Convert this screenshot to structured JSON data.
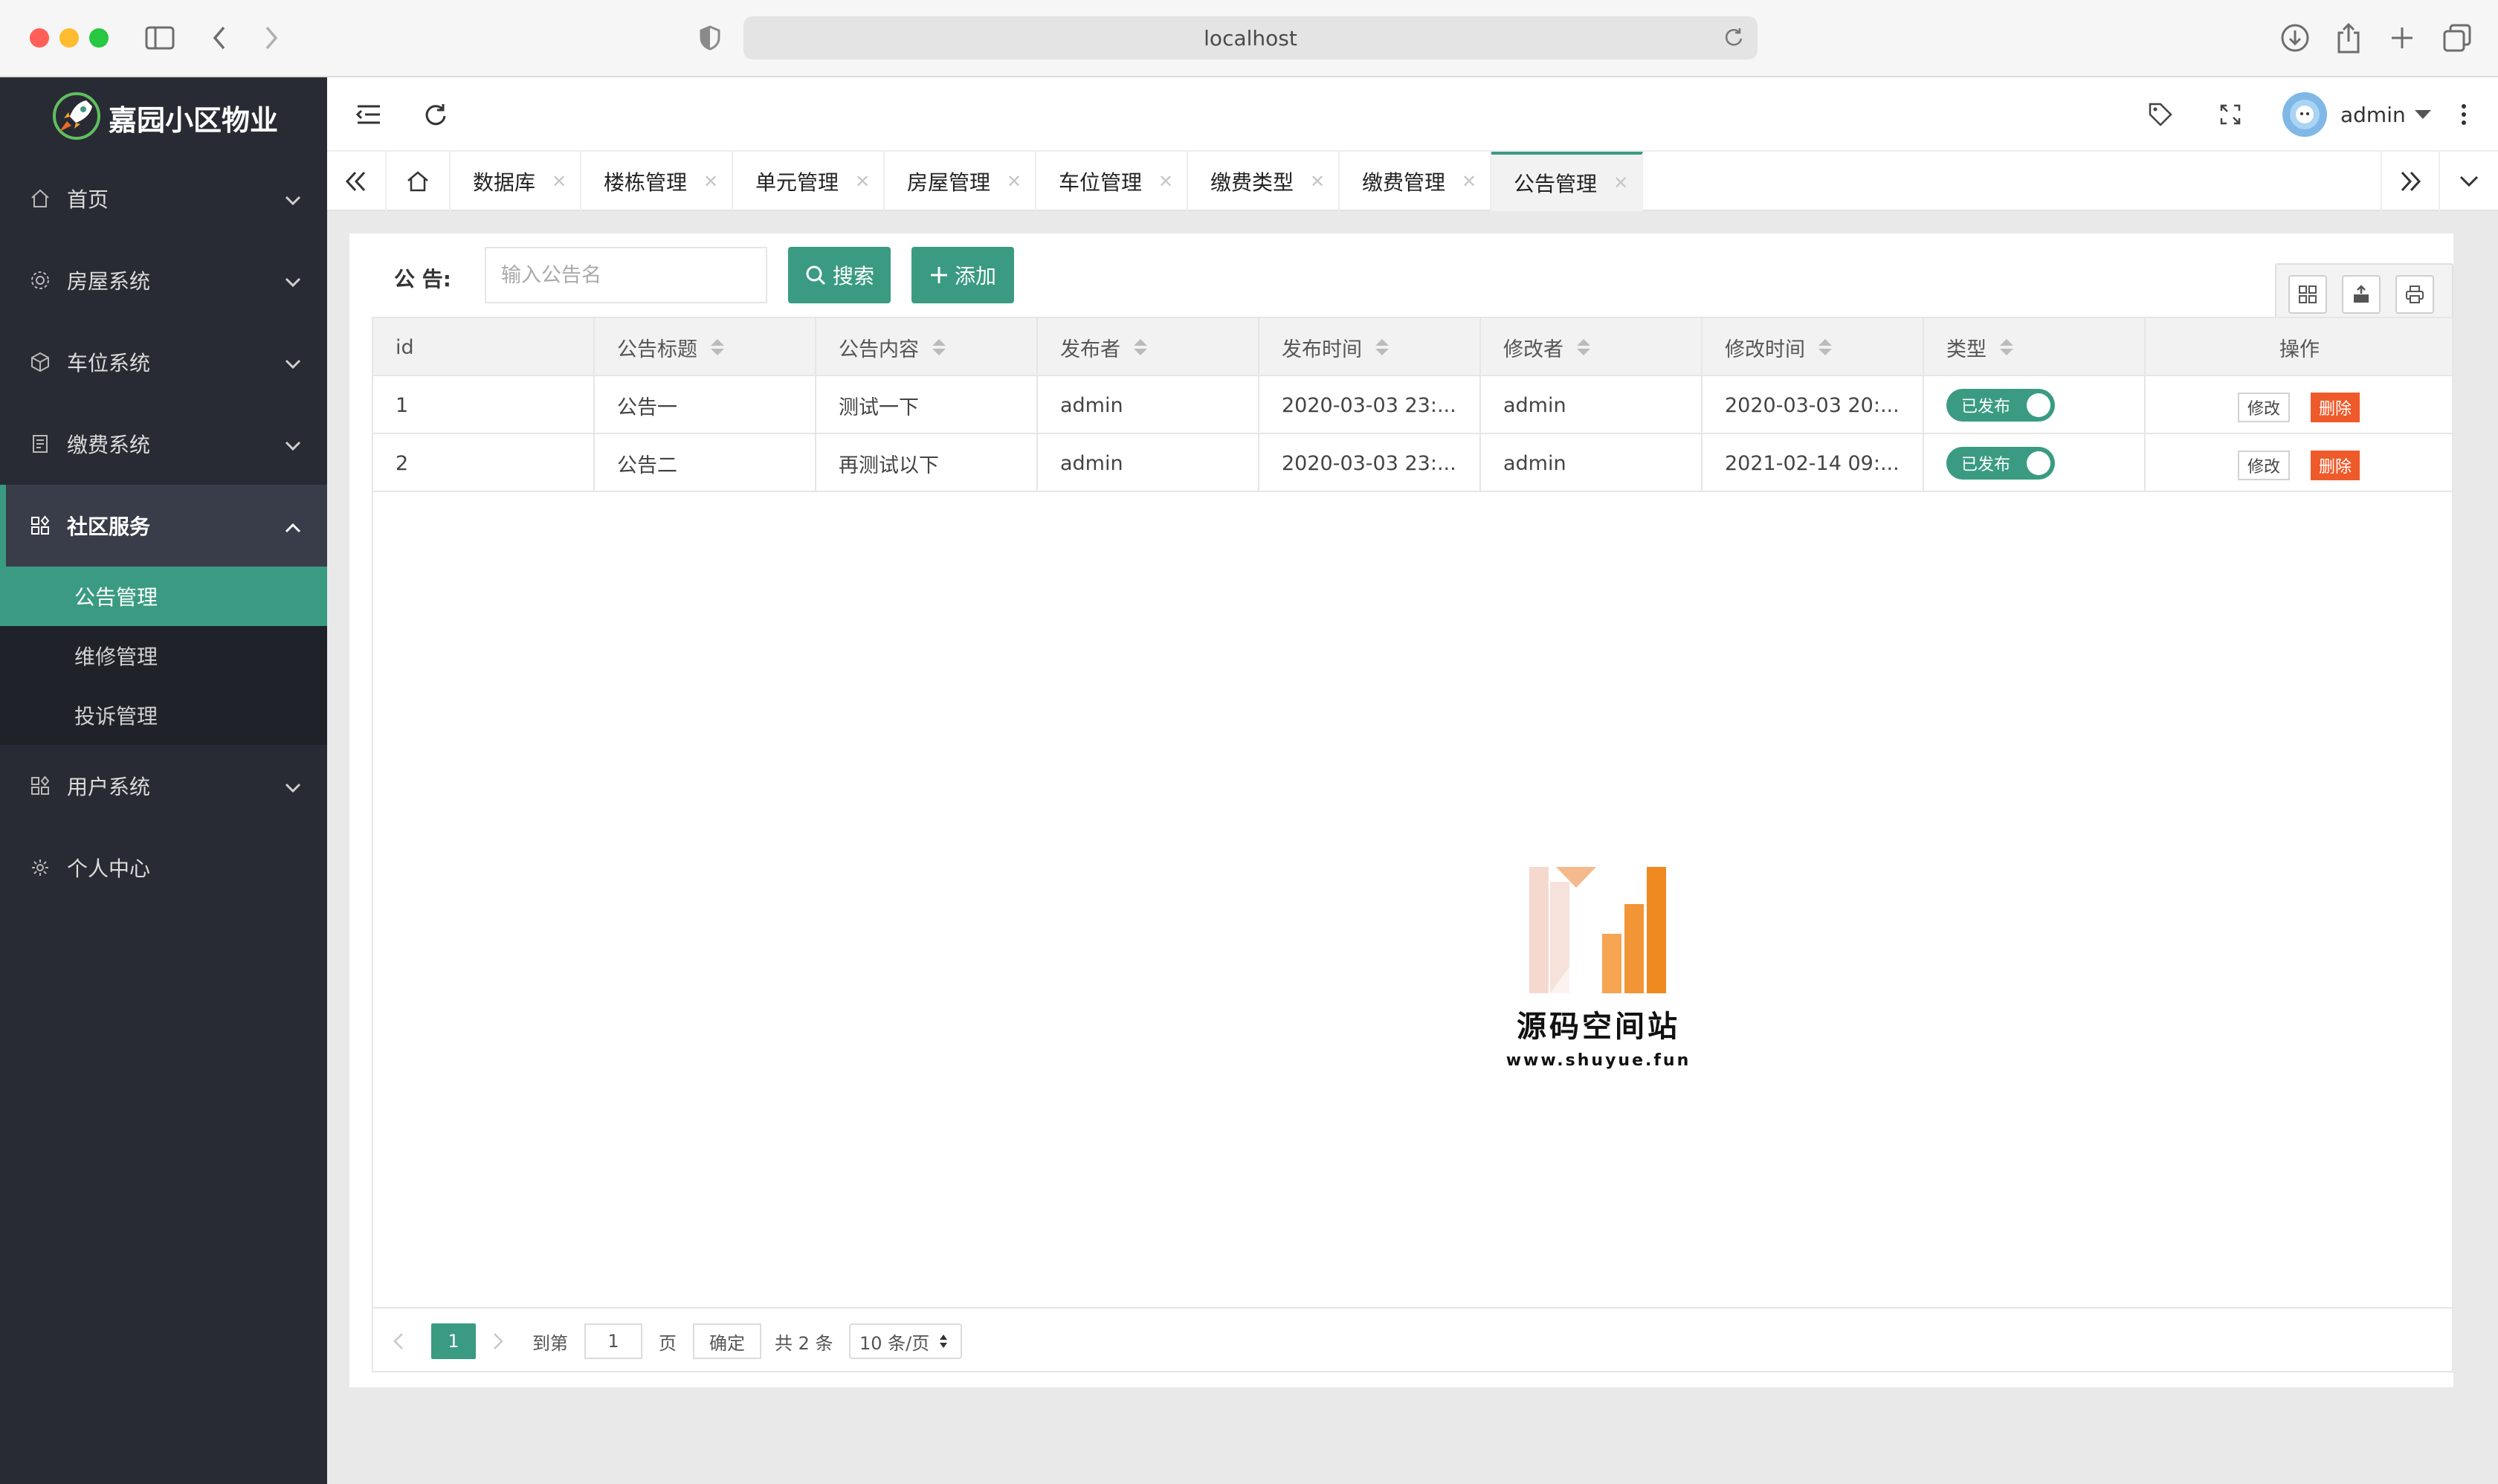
{
  "browser": {
    "url": "localhost"
  },
  "app": {
    "title": "嘉园小区物业"
  },
  "sidebar": {
    "menus": [
      {
        "label": "首页"
      },
      {
        "label": "房屋系统"
      },
      {
        "label": "车位系统"
      },
      {
        "label": "缴费系统"
      },
      {
        "label": "社区服务"
      },
      {
        "label": "用户系统"
      },
      {
        "label": "个人中心"
      }
    ],
    "submenu": [
      {
        "label": "公告管理"
      },
      {
        "label": "维修管理"
      },
      {
        "label": "投诉管理"
      }
    ]
  },
  "header": {
    "user": "admin"
  },
  "tabs": [
    {
      "label": "数据库"
    },
    {
      "label": "楼栋管理"
    },
    {
      "label": "单元管理"
    },
    {
      "label": "房屋管理"
    },
    {
      "label": "车位管理"
    },
    {
      "label": "缴费类型"
    },
    {
      "label": "缴费管理"
    },
    {
      "label": "公告管理"
    }
  ],
  "search": {
    "label": "公 告:",
    "placeholder": "输入公告名",
    "search_button": "搜索",
    "add_button": "添加"
  },
  "table": {
    "columns": [
      "id",
      "公告标题",
      "公告内容",
      "发布者",
      "发布时间",
      "修改者",
      "修改时间",
      "类型",
      "操作"
    ],
    "rows": [
      {
        "id": "1",
        "title": "公告一",
        "content": "测试一下",
        "publisher": "admin",
        "publish_time": "2020-03-03 23:...",
        "modifier": "admin",
        "modify_time": "2020-03-03 20:...",
        "type": "已发布"
      },
      {
        "id": "2",
        "title": "公告二",
        "content": "再测试以下",
        "publisher": "admin",
        "publish_time": "2020-03-03 23:...",
        "modifier": "admin",
        "modify_time": "2021-02-14 09:...",
        "type": "已发布"
      }
    ],
    "edit_label": "修改",
    "delete_label": "删除"
  },
  "watermark": {
    "title": "源码空间站",
    "url": "www.shuyue.fun"
  },
  "pagination": {
    "current_page": "1",
    "goto_label": "到第",
    "goto_value": "1",
    "page_unit": "页",
    "confirm": "确定",
    "total": "共 2 条",
    "page_size": "10 条/页"
  },
  "colors": {
    "accent": "#3a9b82",
    "danger": "#ef5a2b",
    "sidebar": "#282b33"
  }
}
